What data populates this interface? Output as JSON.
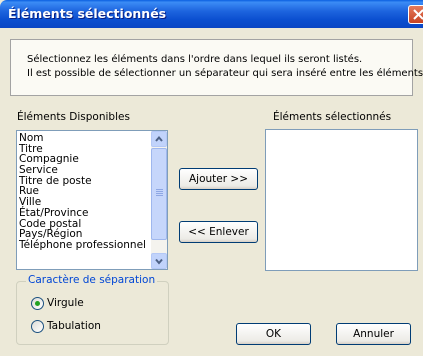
{
  "dialog": {
    "title": "Éléments sélectionnés",
    "info": [
      "Sélectionnez les éléments dans l'ordre dans lequel ils seront listés.",
      "Il est possible de sélectionner un séparateur qui sera inséré entre les éléments."
    ],
    "available": {
      "label": "Éléments Disponibles",
      "items": [
        "Nom",
        "Titre",
        "Compagnie",
        "Service",
        "Titre de poste",
        "Rue",
        "Ville",
        "État/Province",
        "Code postal",
        "Pays/Région",
        "Téléphone professionnel"
      ]
    },
    "selected": {
      "label": "Éléments sélectionnés",
      "items": []
    },
    "buttons": {
      "add": "Ajouter >>",
      "remove": "<< Enlever",
      "ok": "OK",
      "cancel": "Annuler"
    },
    "separator": {
      "title": "Caractère de séparation",
      "options": [
        "Virgule",
        "Tabulation"
      ],
      "selected": "Virgule"
    },
    "colors": {
      "titlebar": "#0a4fd0",
      "window": "#ece9d8",
      "group_title": "#0046d5",
      "close": "#c74322"
    }
  }
}
